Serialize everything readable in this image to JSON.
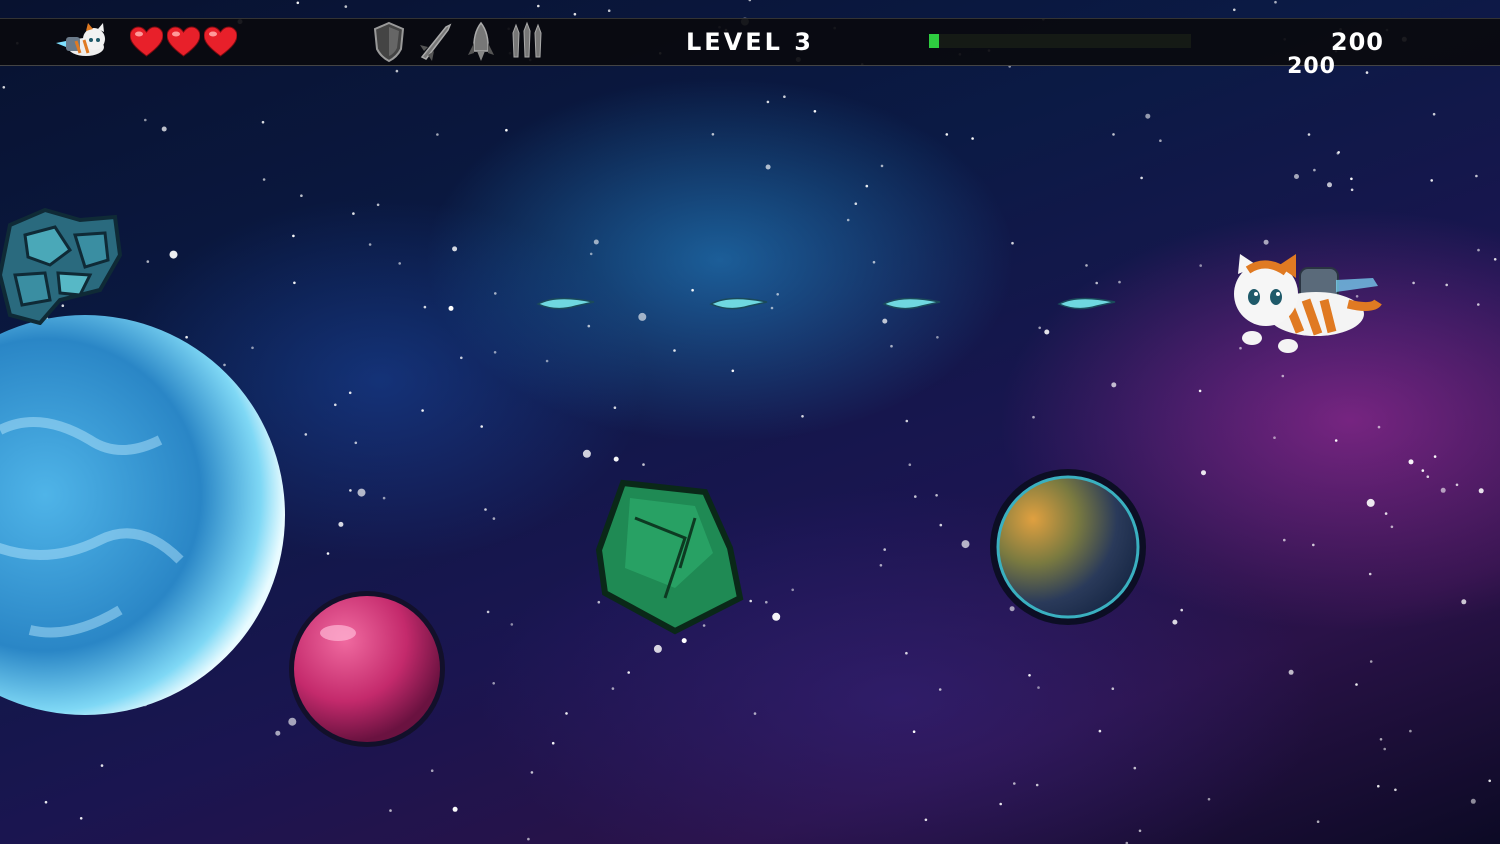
{
  "hud": {
    "lives_count": 3,
    "level_label": "LEVEL 3",
    "progress_fraction": 0.04,
    "score": "200",
    "score_popup": "200",
    "powerups": [
      "shield-icon",
      "missile-icon",
      "rocket-icon",
      "triple-shot-icon"
    ]
  },
  "colors": {
    "hud_bg": "#0a0a0e",
    "progress": "#2ecc40",
    "heart": "#e8202a",
    "text": "#ffffff"
  }
}
